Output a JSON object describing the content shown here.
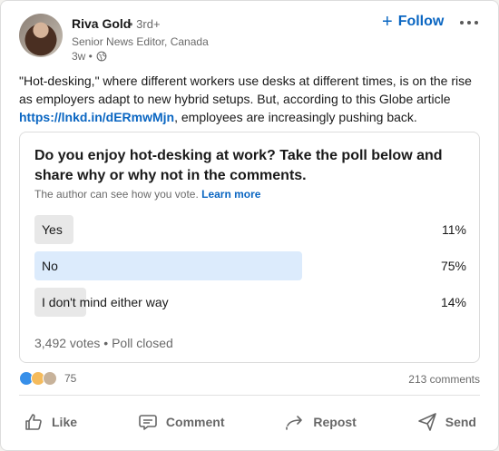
{
  "author": {
    "name": "Riva Gold",
    "degree": "• 3rd+",
    "headline": "Senior News Editor, Canada",
    "time": "3w •"
  },
  "follow_label": "Follow",
  "post": {
    "text_before": "\"Hot-desking,\" where different workers use desks at different times, is on the rise as employers adapt to new hybrid setups. But, according to this Globe article ",
    "link": "https://lnkd.in/dERmwMjn",
    "text_after": ", employees are increasingly pushing back."
  },
  "poll": {
    "question": "Do you enjoy hot-desking at work? Take the poll below and share why or why not in the comments.",
    "note": "The author can see how you vote.",
    "learn_more": "Learn more",
    "options": [
      {
        "label": "Yes",
        "percent_text": "11%",
        "fill": 0.09,
        "selected": false
      },
      {
        "label": "No",
        "percent_text": "75%",
        "fill": 0.62,
        "selected": true
      },
      {
        "label": "I don't mind either way",
        "percent_text": "14%",
        "fill": 0.12,
        "selected": false
      }
    ],
    "meta": "3,492 votes • Poll closed"
  },
  "social": {
    "reactions_count": "75",
    "comments": "213 comments"
  },
  "actions": {
    "like": "Like",
    "comment": "Comment",
    "repost": "Repost",
    "send": "Send"
  },
  "colors": {
    "accent": "#0a66c2",
    "selected_fill": "#dcebfc",
    "bar_fill": "#e8e8e8"
  },
  "icons": {
    "reactions": [
      "like-reaction-icon",
      "celebrate-reaction-icon",
      "insightful-reaction-icon"
    ]
  }
}
